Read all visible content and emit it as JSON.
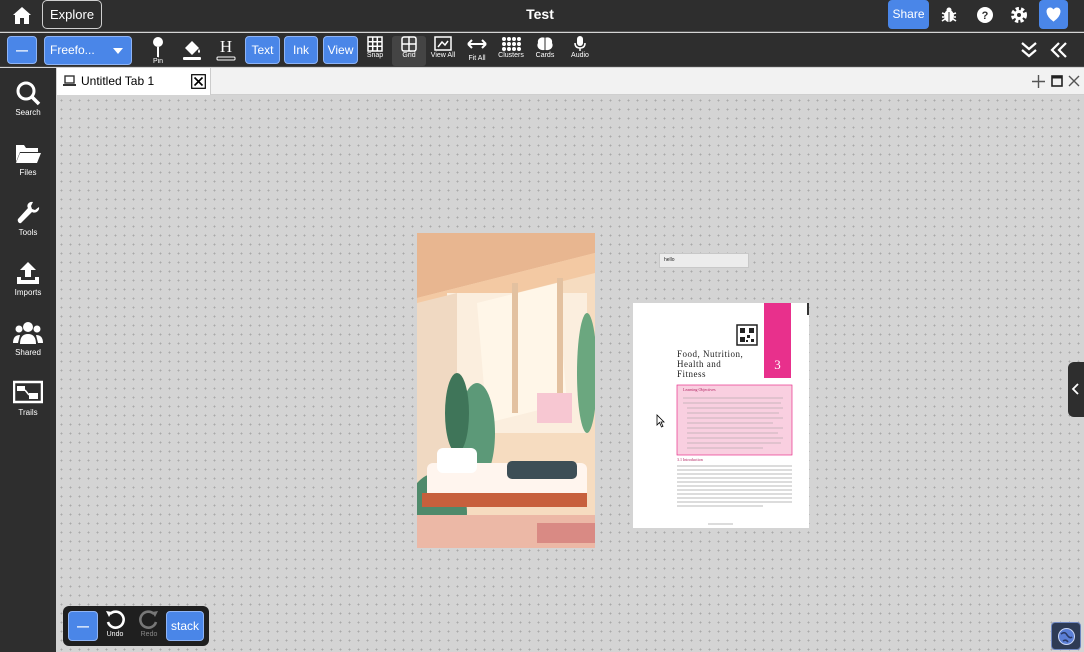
{
  "topbar": {
    "explore_label": "Explore",
    "title": "Test",
    "share_label": "Share"
  },
  "toolbar": {
    "minus_label": "—",
    "mode_select": "Freefo...",
    "pin_label": "Pin",
    "text_label": "Text",
    "ink_label": "Ink",
    "view_label": "View",
    "snap_label": "Snap",
    "grid_label": "Grid",
    "viewall_label": "View All",
    "fitall_label": "Fit All",
    "clusters_label": "Clusters",
    "cards_label": "Cards",
    "audio_label": "Audio"
  },
  "sidebar": {
    "items": [
      {
        "label": "Search"
      },
      {
        "label": "Files"
      },
      {
        "label": "Tools"
      },
      {
        "label": "Imports"
      },
      {
        "label": "Shared"
      },
      {
        "label": "Trails"
      }
    ]
  },
  "tab": {
    "title": "Untitled Tab 1"
  },
  "canvas": {
    "text_note": "hello",
    "doc": {
      "title_line1": "Food, Nutrition,",
      "title_line2": "Health and",
      "title_line3": "Fitness",
      "chapter_number": "3",
      "objectives_heading": "Learning Objectives",
      "section_heading": "3.1 Introduction"
    }
  },
  "bottombar": {
    "minus_label": "—",
    "undo_label": "Undo",
    "redo_label": "Redo",
    "stack_label": "stack"
  },
  "colors": {
    "accent": "#4a86e8",
    "chrome": "#2e2e2e",
    "canvas": "#d4d4d4",
    "doc_pink": "#e8308c"
  }
}
